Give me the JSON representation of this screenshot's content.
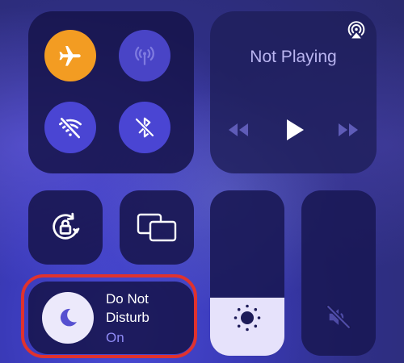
{
  "connectivity": {
    "airplane": {
      "icon": "airplane-icon",
      "active": true,
      "color": "#f39c22"
    },
    "cellular": {
      "icon": "cellular-antenna-icon",
      "active": false
    },
    "wifi": {
      "icon": "wifi-off-icon",
      "active": false
    },
    "bluetooth": {
      "icon": "bluetooth-off-icon",
      "active": false
    }
  },
  "media": {
    "title": "Not Playing",
    "airplay_icon": "airplay-icon",
    "controls": [
      "rewind-icon",
      "play-icon",
      "fast-forward-icon"
    ]
  },
  "rotation_lock": {
    "icon": "rotation-lock-icon"
  },
  "screen_mirroring": {
    "icon": "screen-mirroring-icon"
  },
  "brightness": {
    "icon": "sun-icon",
    "level": 0.35
  },
  "volume": {
    "icon": "speaker-muted-icon",
    "level": 0
  },
  "dnd": {
    "label": "Do Not Disturb",
    "state": "On",
    "icon": "moon-icon",
    "accent": "#8f8af5"
  },
  "highlight": {
    "color": "#e0322e"
  }
}
